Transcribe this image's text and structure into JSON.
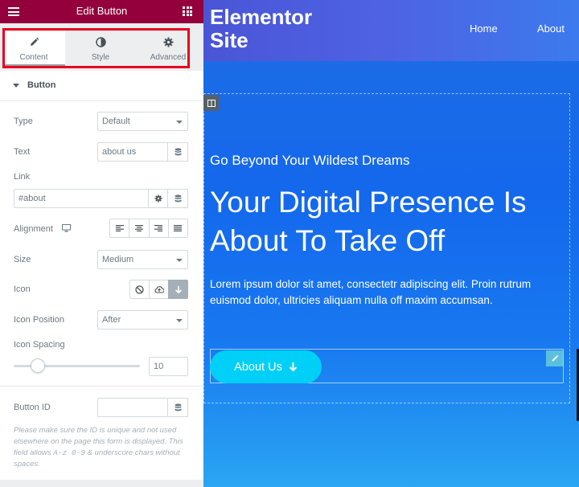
{
  "panel": {
    "title": "Edit Button",
    "tabs": [
      {
        "label": "Content",
        "icon": "pencil-icon",
        "active": true
      },
      {
        "label": "Style",
        "icon": "half-circle-icon",
        "active": false
      },
      {
        "label": "Advanced",
        "icon": "gear-icon",
        "active": false
      }
    ],
    "section_title": "Button",
    "fields": {
      "type": {
        "label": "Type",
        "value": "Default"
      },
      "text": {
        "label": "Text",
        "value": "about us"
      },
      "link": {
        "label": "Link",
        "value": "#about"
      },
      "alignment": {
        "label": "Alignment"
      },
      "size": {
        "label": "Size",
        "value": "Medium"
      },
      "icon": {
        "label": "Icon"
      },
      "icon_position": {
        "label": "Icon Position",
        "value": "After"
      },
      "icon_spacing": {
        "label": "Icon Spacing",
        "value": "10",
        "slider_fraction": 0.17
      },
      "button_id": {
        "label": "Button ID",
        "value": ""
      }
    },
    "note_part1": "Please make sure the ID is unique and not used elsewhere on the page this form is displayed. This field allows ",
    "note_code": "A-z 0-9",
    "note_part2": " & underscore chars without spaces."
  },
  "site": {
    "title": "Elementor Site",
    "nav": [
      "Home",
      "About"
    ],
    "kicker": "Go Beyond Your Wildest Dreams",
    "headline": "Your Digital Presence Is About To Take Off",
    "paragraph": "Lorem ipsum dolor sit amet, consectetr adipiscing elit. Proin rutrum euismod dolor, ultricies aliquam nulla off  maxim accumsan.",
    "cta_label": "About Us"
  },
  "colors": {
    "header_bg": "#93003c",
    "highlight": "#e8001f",
    "cta_bg": "#00cff8"
  }
}
